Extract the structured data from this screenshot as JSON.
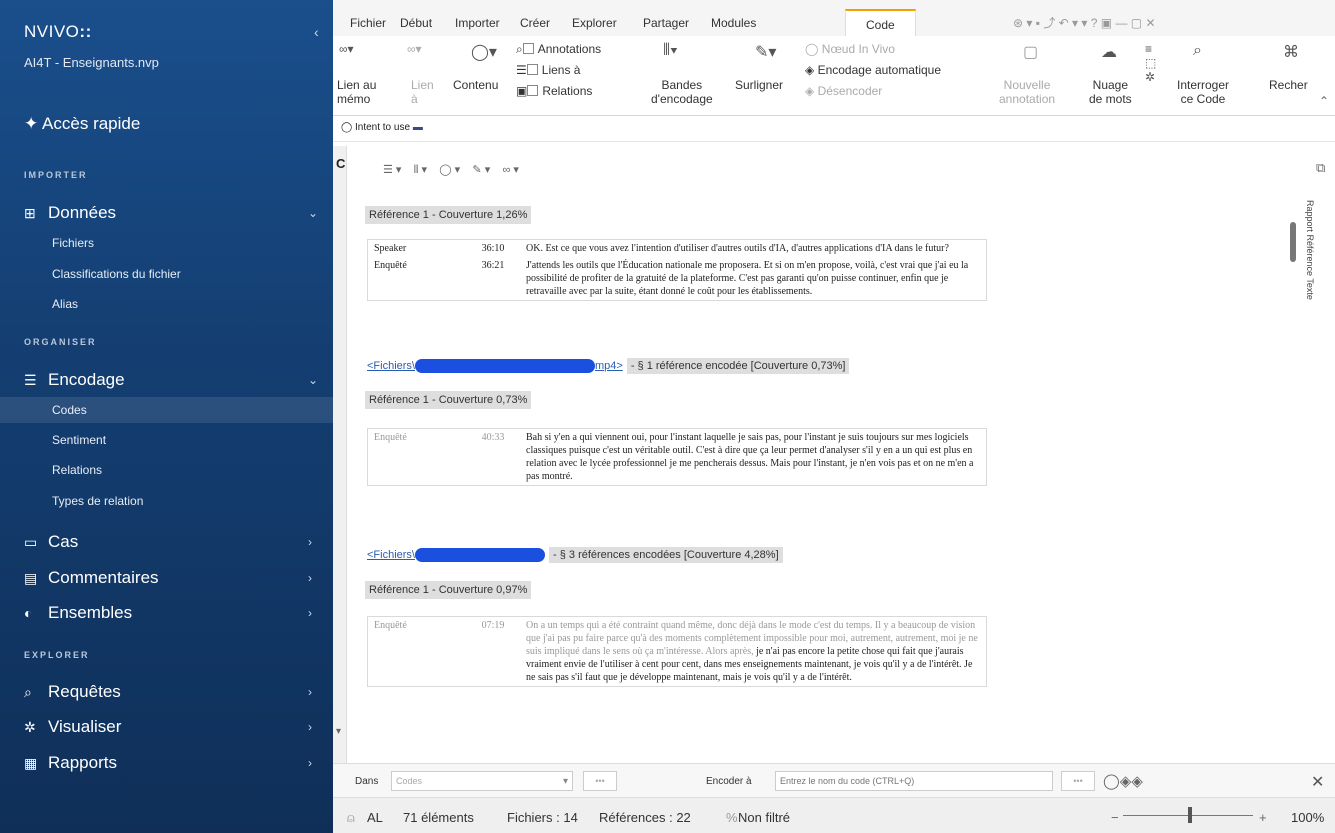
{
  "sidebar": {
    "brand": "NVIVO",
    "brand_mark": "::",
    "project": "AI4T - Enseignants.nvp",
    "quick_access": "Accès rapide",
    "sections": {
      "importer": "IMPORTER",
      "organiser": "ORGANISER",
      "explorer": "EXPLORER"
    },
    "groups": {
      "donnees": "Données",
      "encodage": "Encodage",
      "cas": "Cas",
      "commentaires": "Commentaires",
      "ensembles": "Ensembles",
      "requetes": "Requêtes",
      "visualiser": "Visualiser",
      "rapports": "Rapports"
    },
    "donnees_items": [
      "Fichiers",
      "Classifications du fichier",
      "Alias"
    ],
    "encodage_items": [
      "Codes",
      "Sentiment",
      "Relations",
      "Types de relation"
    ]
  },
  "tabs": [
    "Fichier",
    "Début",
    "Importer",
    "Créer",
    "Explorer",
    "Partager",
    "Modules",
    "Code"
  ],
  "ribbon": {
    "lien_memo": "Lien au\nmémo",
    "lien": "Lien\nà",
    "contenu": "Contenu",
    "annotations": "Annotations",
    "liens_a": "Liens à",
    "relations": "Relations",
    "bandes": "Bandes\nd'encodage",
    "surligner": "Surligner",
    "noeud_in_vivo": "Nœud In Vivo",
    "encodage_auto": "Encodage automatique",
    "desencoder": "Désencoder",
    "nouvelle_annotation": "Nouvelle\nannotation",
    "nuage": "Nuage\nde mots",
    "interroger": "Interroger\nce Code",
    "rechercher": "Recher"
  },
  "node": {
    "name": "Intent to use"
  },
  "content": {
    "ref1_bar": "Référence 1 - Couverture 1,26%",
    "tbl1": [
      {
        "speaker": "Speaker",
        "time": "36:10",
        "text": "OK. Est ce que vous avez l'intention d'utiliser d'autres outils d'IA, d'autres applications d'IA dans le futur?"
      },
      {
        "speaker": "Enquêté",
        "time": "36:21",
        "text": "J'attends les outils que l'Éducation nationale me proposera. Et si on m'en propose, voilà, c'est vrai que j'ai eu la possibilité de profiter de la gratuité de la plateforme. C'est pas garanti qu'on puisse continuer, enfin que je retravaille avec par la suite, étant donné le coût pour les établissements."
      }
    ],
    "file1_prefix": "<Fichiers\\",
    "file1_suffix": "mp4>",
    "file1_meta": "- § 1 référence encodée  [Couverture 0,73%]",
    "ref2_bar": "Référence 1 - Couverture 0,73%",
    "tbl2": [
      {
        "speaker": "Enquêté",
        "time": "40:33",
        "text": "Bah si y'en a qui viennent oui, pour l'instant laquelle je sais pas, pour l'instant je suis toujours sur mes logiciels classiques puisque c'est un véritable outil. C'est à dire que ça leur permet d'analyser s'il y en a un qui est plus en relation avec le lycée professionnel je me pencherais dessus. Mais pour l'instant, je n'en vois pas et on ne m'en a pas montré."
      }
    ],
    "file2_prefix": "<Fichiers\\",
    "file2_meta": "- § 3 références encodées  [Couverture 4,28%]",
    "ref3_bar": "Référence 1 - Couverture 0,97%",
    "tbl3_speaker": "Enquêté",
    "tbl3_time": "07:19",
    "tbl3_text_grey": "On a un temps qui a été contraint quand même, donc déjà dans le mode c'est du temps. Il y a beaucoup de vision que j'ai pas pu faire parce qu'à des moments complètement impossible pour moi, autrement, autrement, moi je ne suis impliqué dans le sens où ça m'intéresse. Alors après,",
    "tbl3_text_black": "je n'ai pas encore la petite chose qui fait que j'aurais vraiment envie de l'utiliser à cent pour cent, dans mes enseignements maintenant, je vois qu'il y a de l'intérêt. Je ne sais pas s'il faut que je développe maintenant, mais je vois qu'il y a de l'intérêt.",
    "side_tabs": "Rapport   Référence   Texte"
  },
  "encode_bar": {
    "dans_label": "Dans",
    "dans_value": "Codes",
    "encoder_label": "Encoder à",
    "encoder_placeholder": "Entrez le nom du code (CTRL+Q)"
  },
  "status": {
    "user": "AL",
    "elements": "71 éléments",
    "files": "Fichiers : 14",
    "refs": "Références : 22",
    "filter": "Non filtré",
    "zoom": "100%"
  }
}
